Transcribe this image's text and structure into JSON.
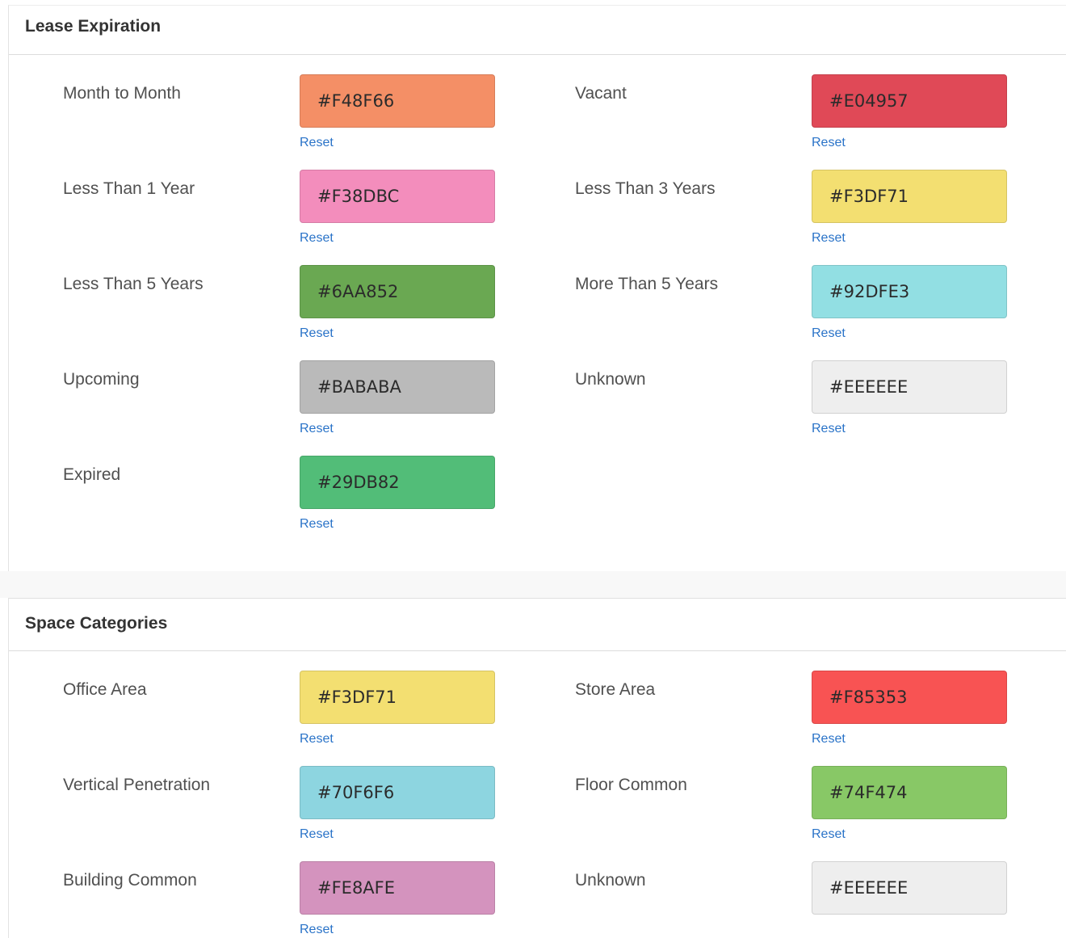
{
  "lease": {
    "title": "Lease Expiration",
    "items": [
      {
        "label": "Month to Month",
        "value": "#F48F66",
        "color": "#F48F66",
        "reset": "Reset"
      },
      {
        "label": "Vacant",
        "value": "#E04957",
        "color": "#E04957",
        "reset": "Reset"
      },
      {
        "label": "Less Than 1 Year",
        "value": "#F38DBC",
        "color": "#F38DBC",
        "reset": "Reset"
      },
      {
        "label": "Less Than 3 Years",
        "value": "#F3DF71",
        "color": "#F3DF71",
        "reset": "Reset"
      },
      {
        "label": "Less Than 5 Years",
        "value": "#6AA852",
        "color": "#6AA852",
        "reset": "Reset"
      },
      {
        "label": "More Than 5 Years",
        "value": "#92DFE3",
        "color": "#92DFE3",
        "reset": "Reset"
      },
      {
        "label": "Upcoming",
        "value": "#BABABA",
        "color": "#BABABA",
        "reset": "Reset"
      },
      {
        "label": "Unknown",
        "value": "#EEEEEE",
        "color": "#EEEEEE",
        "reset": "Reset"
      },
      {
        "label": "Expired",
        "value": "#29DB82",
        "color": "#52BD78",
        "reset": "Reset"
      }
    ]
  },
  "space": {
    "title": "Space Categories",
    "items": [
      {
        "label": "Office Area",
        "value": "#F3DF71",
        "color": "#F3DF71",
        "reset": "Reset"
      },
      {
        "label": "Store Area",
        "value": "#F85353",
        "color": "#F85353",
        "reset": "Reset"
      },
      {
        "label": "Vertical Penetration",
        "value": "#70F6F6",
        "color": "#8DD5E0",
        "reset": "Reset"
      },
      {
        "label": "Floor Common",
        "value": "#74F474",
        "color": "#88C866",
        "reset": "Reset"
      },
      {
        "label": "Building Common",
        "value": "#FE8AFE",
        "color": "#D493BE",
        "reset": "Reset"
      },
      {
        "label": "Unknown",
        "value": "#EEEEEE",
        "color": "#EEEEEE"
      }
    ]
  }
}
